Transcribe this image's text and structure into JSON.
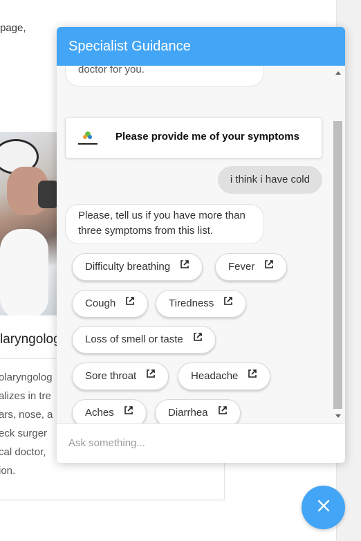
{
  "background": {
    "top_text": "page,",
    "heading": "laryngolog",
    "card_lines": [
      "olaryngolog",
      "alizes in tre",
      "ars, nose, a",
      "eck surger",
      "cal doctor,",
      "ion."
    ]
  },
  "chat": {
    "title": "Specialist Guidance",
    "cut_message": "doctor for you.",
    "card_message": "Please provide me of your symptoms",
    "user_message": "i think i have cold",
    "bot_question": "Please, tell us if you have more than three symptoms from this list.",
    "options": [
      {
        "label": "Difficulty breathing",
        "icon": "external-link-icon"
      },
      {
        "label": "Fever",
        "icon": "external-link-icon"
      },
      {
        "label": "Cough",
        "icon": "external-link-icon"
      },
      {
        "label": "Tiredness",
        "icon": "external-link-icon"
      },
      {
        "label": "Loss of smell or taste",
        "icon": "external-link-icon"
      },
      {
        "label": "Sore throat",
        "icon": "external-link-icon"
      },
      {
        "label": "Headache",
        "icon": "external-link-icon"
      },
      {
        "label": "Aches",
        "icon": "external-link-icon"
      },
      {
        "label": "Diarrhea",
        "icon": "external-link-icon"
      }
    ],
    "input_placeholder": "Ask something..."
  },
  "fab": {
    "icon": "close-icon"
  },
  "colors": {
    "accent": "#42a5f5",
    "user_bubble": "#e0e0e0"
  }
}
